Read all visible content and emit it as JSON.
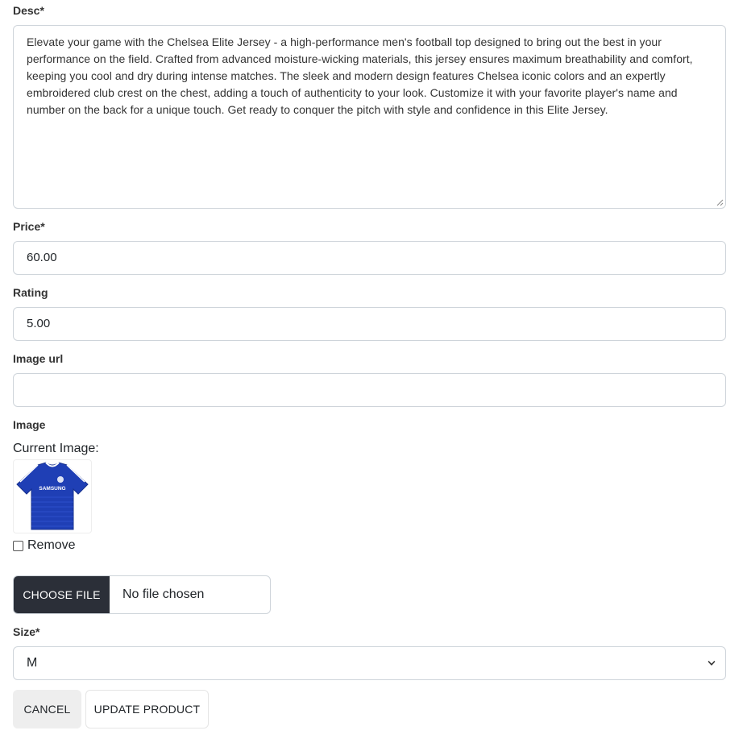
{
  "form": {
    "desc_label": "Desc*",
    "desc_value": "Elevate your game with the Chelsea Elite Jersey - a high-performance men's football top designed to bring out the best in your performance on the field. Crafted from advanced moisture-wicking materials, this jersey ensures maximum breathability and comfort, keeping you cool and dry during intense matches. The sleek and modern design features Chelsea iconic colors and an expertly embroidered club crest on the chest, adding a touch of authenticity to your look. Customize it with your favorite player's name and number on the back for a unique touch. Get ready to conquer the pitch with style and confidence in this Elite Jersey.",
    "price_label": "Price*",
    "price_value": "60.00",
    "rating_label": "Rating",
    "rating_value": "5.00",
    "image_url_label": "Image url",
    "image_url_value": "",
    "image_label": "Image",
    "current_image_label": "Current Image:",
    "jersey_sponsor_text": "SAMSUNG",
    "remove_label": "Remove",
    "remove_checked": false,
    "choose_file_label": "CHOOSE FILE",
    "no_file_text": "No file chosen",
    "size_label": "Size*",
    "size_value": "M"
  },
  "actions": {
    "cancel_label": "CANCEL",
    "update_label": "UPDATE PRODUCT"
  },
  "colors": {
    "file_button_bg": "#2b2f38",
    "jersey_blue": "#1f3fb5"
  },
  "icons": {
    "select": "chevron-down-icon",
    "resize": "resize-grip-icon"
  }
}
